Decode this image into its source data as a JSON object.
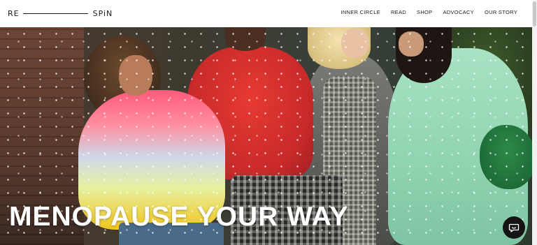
{
  "brand": {
    "left": "RE",
    "right": "SPiN"
  },
  "nav": {
    "items": [
      {
        "label": "INNER CIRCLE"
      },
      {
        "label": "READ"
      },
      {
        "label": "SHOP"
      },
      {
        "label": "ADVOCACY"
      },
      {
        "label": "OUR STORY"
      }
    ]
  },
  "hero": {
    "headline": "MENOPAUSE YOUR WAY"
  },
  "chat": {
    "icon": "chat-bubble-icon"
  },
  "colors": {
    "text": "#1a1a1a",
    "header_bg": "#ffffff",
    "chat_bg": "#141414",
    "headline": "#ffffff"
  }
}
